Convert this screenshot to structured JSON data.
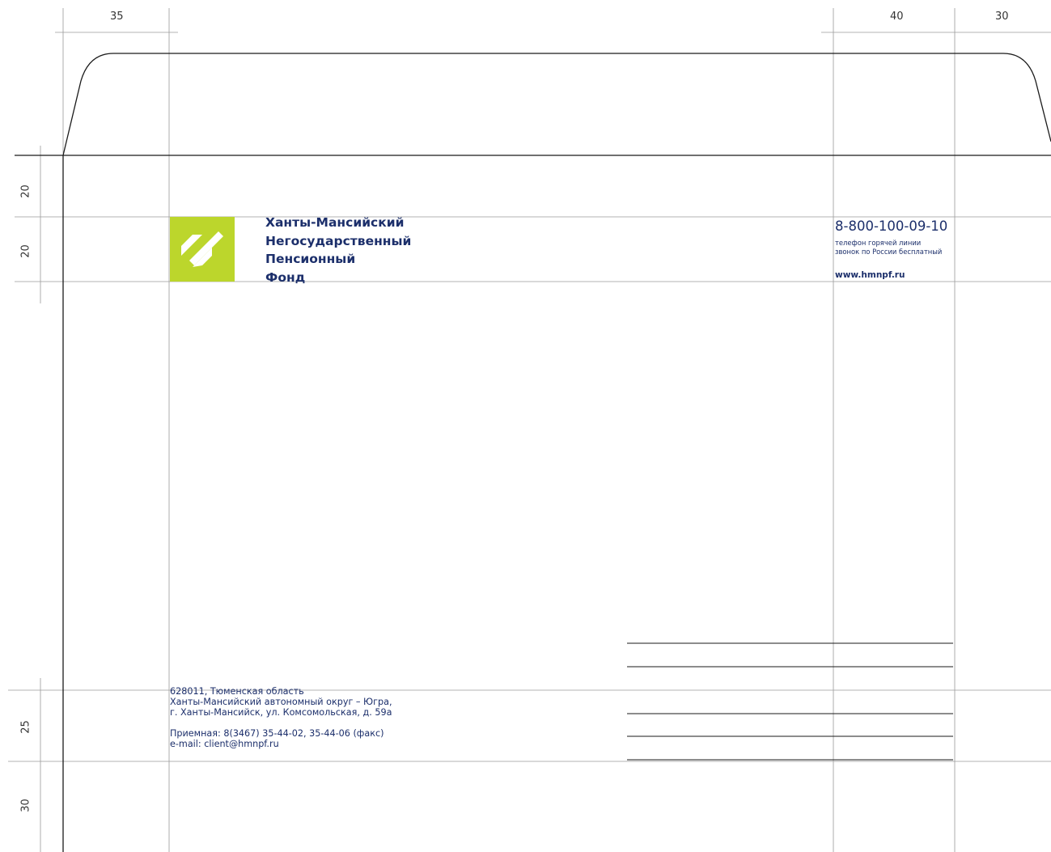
{
  "dimensions": {
    "left_margin": "35",
    "right_col": "40",
    "right_margin": "30",
    "top_band": "20",
    "header_band": "20",
    "footer_band": "25",
    "bottom_band": "30"
  },
  "organization": {
    "name_lines": [
      "Ханты-Мансийский",
      "Негосударственный",
      "Пенсионный",
      "Фонд"
    ],
    "logo_color": "#bcd62c",
    "text_color": "#1c2f6b"
  },
  "contacts": {
    "hotline_number": "8-800-100-09-10",
    "hotline_caption_1": "телефон горячей линии",
    "hotline_caption_2": "звонок по России бесплатный",
    "website": "www.hmnpf.ru"
  },
  "address": {
    "line_1": "628011, Тюменская область",
    "line_2": "Ханты-Мансийский автономный округ – Югра,",
    "line_3": "г. Ханты-Мансийск, ул. Комсомольская, д. 59а",
    "reception": "Приемная: 8(3467) 35-44-02, 35-44-06 (факс)",
    "email": "e-mail: client@hmnpf.ru"
  }
}
